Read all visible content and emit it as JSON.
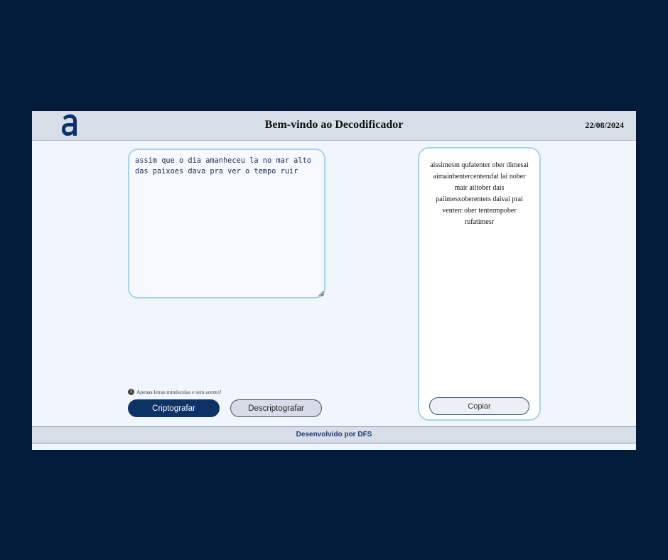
{
  "header": {
    "title": "Bem-vindo ao Decodificador",
    "date": "22/08/2024",
    "logo_icon": "alura-a-logo-icon"
  },
  "input": {
    "value": "assim que o dia amanheceu la no mar alto das paixoes dava pra ver o tempo ruir",
    "placeholder": ""
  },
  "info": {
    "text": "Apenas letras minúsculas e sem acento!",
    "icon": "info-icon"
  },
  "buttons": {
    "encrypt_label": "Criptografar",
    "decrypt_label": "Descriptografar",
    "copy_label": "Copiar"
  },
  "output": {
    "text": "aissimesm qufatenter ober dimesai aimainhentercenterufat lai nober mair ailtober dais paiimesxoberenters daivai prai venterr ober tentermpober rufatimesr"
  },
  "footer": {
    "text": "Desenvolvido por DFS"
  },
  "colors": {
    "page_background": "#021b3a",
    "app_background": "#f1f5fc",
    "header_background": "#d8dee8",
    "primary_button": "#0c3266",
    "panel_border": "#a7d3e8",
    "footer_text": "#1c3b6e"
  }
}
